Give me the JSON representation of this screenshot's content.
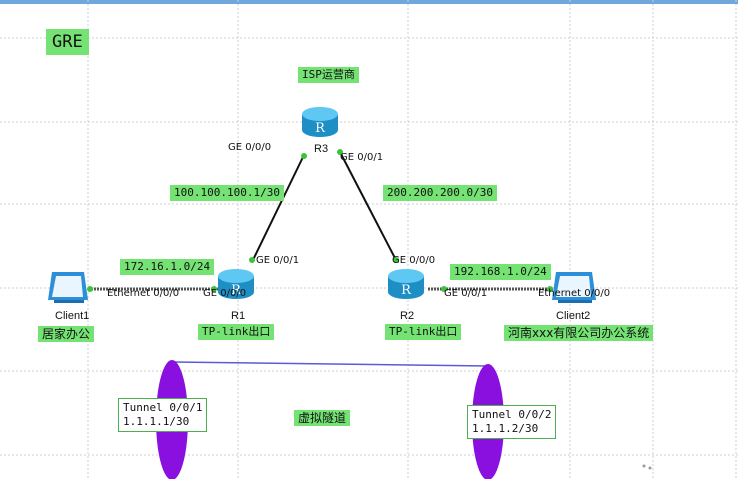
{
  "title": "GRE",
  "isp_label": "ISP运营商",
  "routers": {
    "r1": {
      "name": "R1",
      "label": "TP-link出口"
    },
    "r2": {
      "name": "R2",
      "label": "TP-link出口"
    },
    "r3": {
      "name": "R3",
      "label": "R"
    }
  },
  "clients": {
    "client1": {
      "name": "Client1",
      "location": "居家办公"
    },
    "client2": {
      "name": "Client2",
      "location": "河南xxx有限公司办公系统"
    }
  },
  "ports": {
    "r3_ge000": "GE 0/0/0",
    "r3_ge001": "GE 0/0/1",
    "r1_ge001": "GE 0/0/1",
    "r1_ge000": "GE 0/0/0",
    "r2_ge000": "GE 0/0/0",
    "r2_ge001": "GE 0/0/1",
    "client1_eth": "Ethernet 0/0/0",
    "client2_eth": "Ethernet 0/0/0"
  },
  "subnets": {
    "r1_r3": "100.100.100.1/30",
    "r2_r3": "200.200.200.0/30",
    "lan1": "172.16.1.0/24",
    "lan2": "192.168.1.0/24"
  },
  "tunnel": {
    "label": "虚拟隧道",
    "left": {
      "name": "Tunnel 0/0/1",
      "ip": "1.1.1.1/30"
    },
    "right": {
      "name": "Tunnel 0/0/2",
      "ip": "1.1.1.2/30"
    }
  },
  "colors": {
    "label_bg": "#74e374",
    "router": "#2aa8dc",
    "tunnel": "#8a10e0",
    "tunnel_line": "#5b5bd6"
  }
}
